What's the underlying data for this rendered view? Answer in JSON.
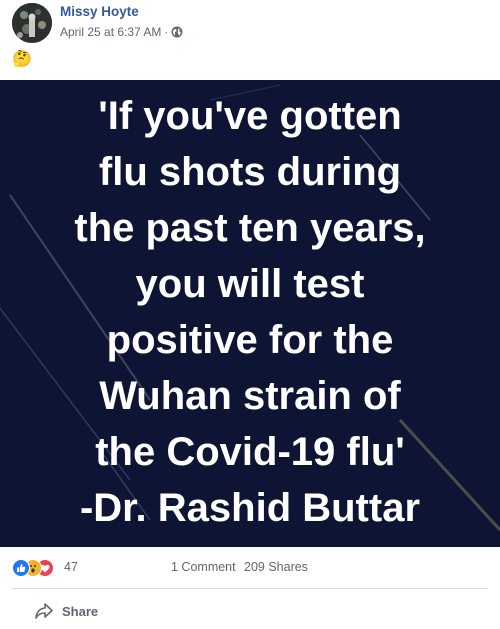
{
  "post": {
    "author": "Missy Hoyte",
    "timestamp": "April 25 at 6:37 AM",
    "separator": "·",
    "audience_icon": "globe-icon",
    "text_emoji": "🤔",
    "image": {
      "lines": [
        "'If you've gotten",
        "flu shots during",
        "the past ten years,",
        "you will test",
        "positive for the",
        "Wuhan strain of",
        "the Covid-19 flu'",
        "-Dr. Rashid Buttar"
      ],
      "background_color": "#0e1433",
      "text_color": "#ffffff"
    }
  },
  "reactions": {
    "icons": [
      "like-icon",
      "wow-icon",
      "love-icon"
    ],
    "count": "47",
    "comments": "1 Comment",
    "shares": "209 Shares"
  },
  "actions": {
    "share_label": "Share"
  },
  "colors": {
    "author_link": "#385898",
    "meta_text": "#606770",
    "divider": "#dadde1"
  }
}
